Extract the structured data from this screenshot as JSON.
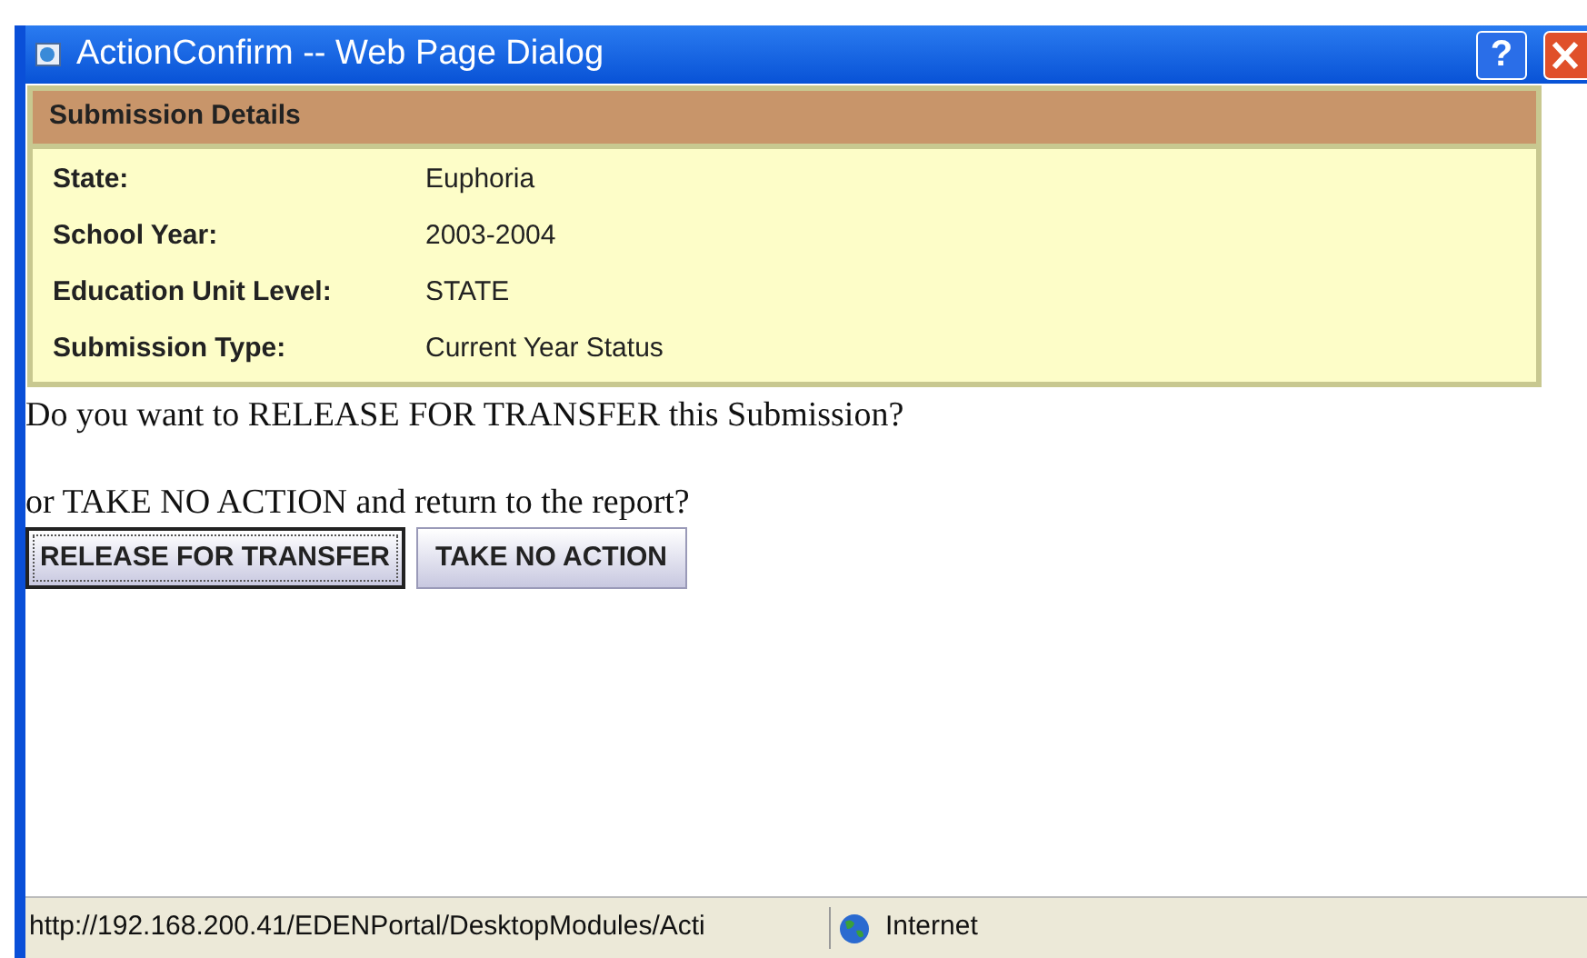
{
  "window": {
    "title": "ActionConfirm -- Web Page Dialog",
    "help_button": "?"
  },
  "details": {
    "heading": "Submission Details",
    "rows": [
      {
        "label": "State:",
        "value": "Euphoria"
      },
      {
        "label": "School Year:",
        "value": "2003-2004"
      },
      {
        "label": "Education Unit Level:",
        "value": "STATE"
      },
      {
        "label": "Submission Type:",
        "value": "Current Year Status"
      }
    ]
  },
  "question": "Do you want to RELEASE FOR TRANSFER this Submission?",
  "alternative": "or TAKE NO ACTION and return to the report?",
  "buttons": [
    {
      "label": "RELEASE FOR TRANSFER",
      "focused": true
    },
    {
      "label": "TAKE NO ACTION",
      "focused": false
    }
  ],
  "status_bar": {
    "url": "http://192.168.200.41/EDENPortal/DesktopModules/Acti",
    "zone": "Internet"
  }
}
